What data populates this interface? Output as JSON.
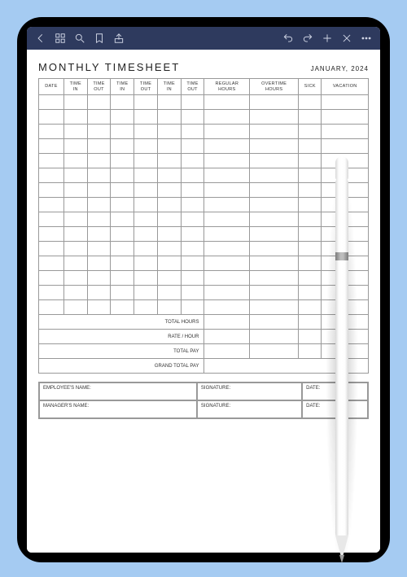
{
  "title": "MONTHLY TIMESHEET",
  "period": "JANUARY, 2024",
  "columns": [
    "DATE",
    "TIME IN",
    "TIME OUT",
    "TIME IN",
    "TIME OUT",
    "TIME IN",
    "TIME OUT",
    "REGULAR HOURS",
    "OVERTIME HOURS",
    "SICK",
    "VACATION"
  ],
  "body_row_count": 15,
  "summary": {
    "total_hours": "TOTAL HOURS",
    "rate_hour": "RATE / HOUR",
    "total_pay": "TOTAL PAY",
    "grand_total_pay": "GRAND TOTAL PAY"
  },
  "signatures": {
    "employee": "EMPLOYEE'S NAME:",
    "manager": "MANAGER'S NAME:",
    "signature": "SIGNATURE:",
    "date": "DATE:"
  },
  "toolbar_icons": {
    "left": [
      "back-icon",
      "grid-icon",
      "search-icon",
      "bookmark-icon",
      "share-icon"
    ],
    "right": [
      "undo-icon",
      "redo-icon",
      "add-icon",
      "close-icon",
      "more-icon"
    ]
  }
}
